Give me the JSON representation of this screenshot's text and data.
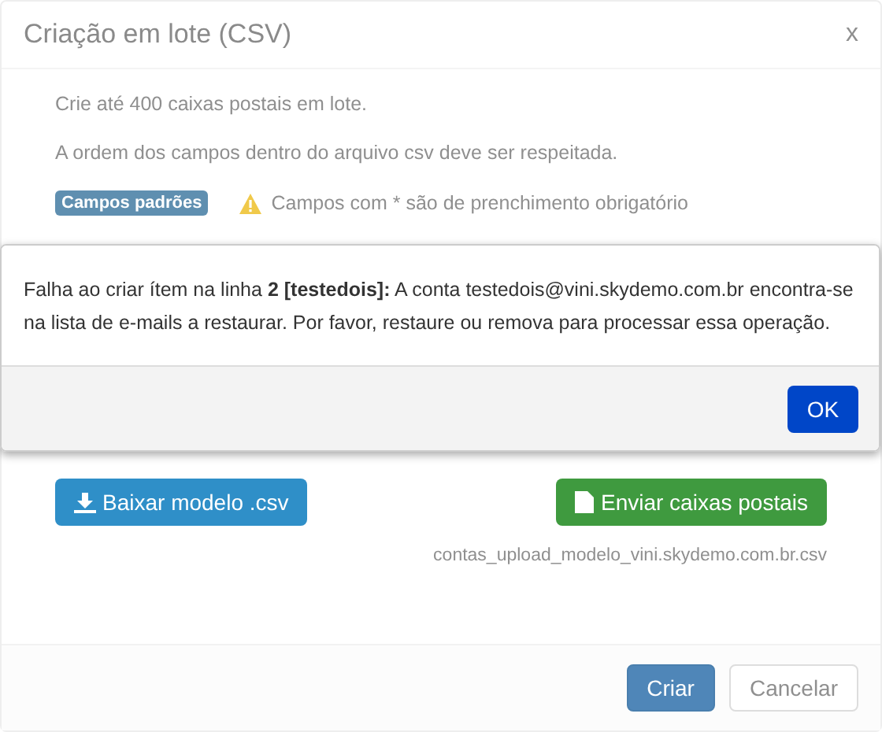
{
  "modal": {
    "title": "Criação em lote (CSV)",
    "close": "x",
    "lines": [
      "Crie até 400 caixas postais em lote.",
      "A ordem dos campos dentro do arquivo csv deve ser respeitada."
    ],
    "badge": "Campos padrões",
    "warning": "Campos com * são de prenchimento obrigatório",
    "download_button": "Baixar modelo .csv",
    "upload_button": "Enviar caixas postais",
    "filename": "contas_upload_modelo_vini.skydemo.com.br.csv",
    "footer_buttons": [
      {
        "label": "Criar",
        "kind": "primary"
      },
      {
        "label": "Cancelar",
        "kind": "default"
      }
    ]
  },
  "alert": {
    "message": "Falha ao criar ítem na linha **2 [testedois]:** A conta testedois@vini.skydemo.com.br encontra-se na lista de e-mails a restaurar. Por favor, restaure ou remova para processar essa operação.",
    "button": "OK"
  }
}
